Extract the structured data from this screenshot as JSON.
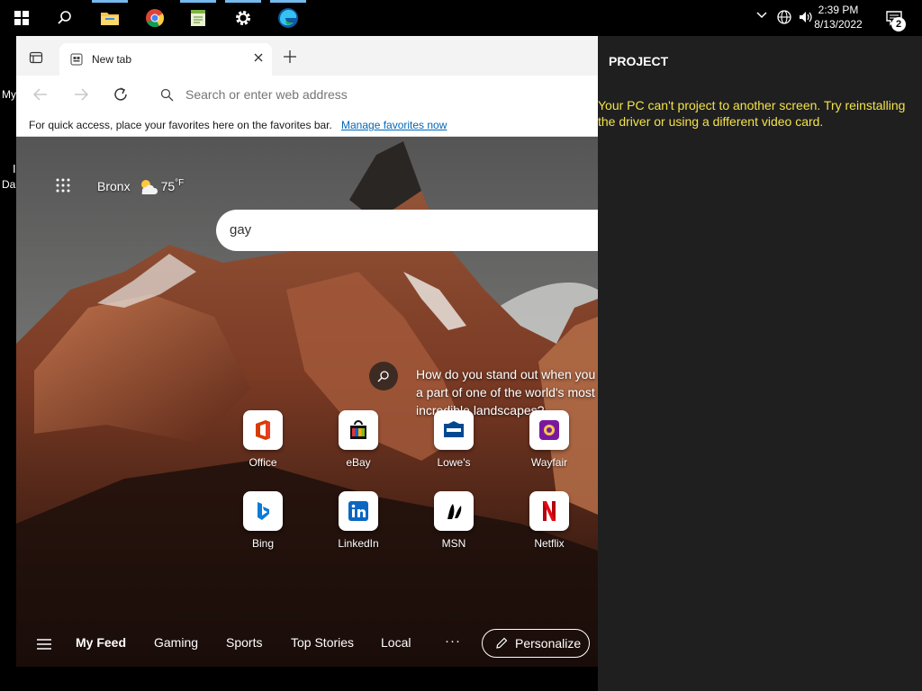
{
  "taskbar": {
    "time": "2:39 PM",
    "date": "8/13/2022",
    "notifications_count": "2"
  },
  "desktop": {
    "partial_label_1": "My",
    "partial_label_2": "I",
    "partial_label_3": "Da"
  },
  "browser": {
    "tab_title": "New tab",
    "address_placeholder": "Search or enter web address",
    "favorites_bar_text": "For quick access, place your favorites here on the favorites bar.",
    "manage_favorites_link": "Manage favorites now",
    "link_color": "#0067b8"
  },
  "newtab": {
    "location": "Bronx",
    "temperature": "75",
    "temp_unit": "°F",
    "search_value": "gay",
    "image_question": "How do you stand out when you're a part of one of the world's most incredible landscapes?",
    "image_question_lines": [
      "How do you stand out when you",
      "a part of one of the world's most",
      "incredible landscapes?"
    ],
    "quick_links": [
      {
        "label": "Office",
        "icon": "office-icon",
        "color": "#d83b01"
      },
      {
        "label": "eBay",
        "icon": "ebay-icon",
        "color": "#e53238"
      },
      {
        "label": "Lowe's",
        "icon": "lowes-icon",
        "color": "#004990"
      },
      {
        "label": "Wayfair",
        "icon": "wayfair-icon",
        "color": "#7b189f"
      },
      {
        "label": "Bing",
        "icon": "bing-icon",
        "color": "#008373"
      },
      {
        "label": "LinkedIn",
        "icon": "linkedin-icon",
        "color": "#0a66c2"
      },
      {
        "label": "MSN",
        "icon": "msn-icon",
        "color": "#000000"
      },
      {
        "label": "Netflix",
        "icon": "netflix-icon",
        "color": "#e50914"
      }
    ],
    "feed_nav": {
      "items": [
        "My Feed",
        "Gaming",
        "Sports",
        "Top Stories",
        "Local"
      ],
      "more": "···",
      "personalize": "Personalize"
    }
  },
  "project_pane": {
    "title": "PROJECT",
    "message": "Your PC can't project to another screen. Try reinstalling the driver or using a different video card.",
    "message_color": "#f4e24a"
  }
}
